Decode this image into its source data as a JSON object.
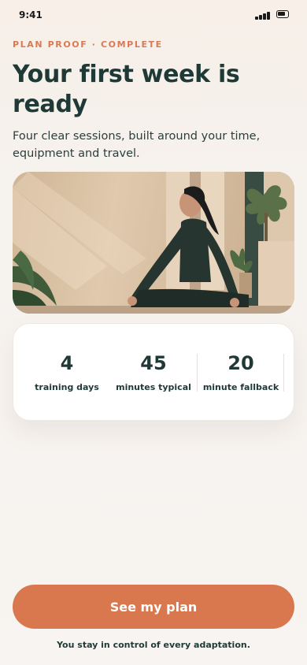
{
  "status": {
    "time": "9:41"
  },
  "header": {
    "eyebrow": "PLAN PROOF · COMPLETE",
    "title": "Your first week is ready",
    "subtitle": "Four clear sessions, built around your time, equipment and travel."
  },
  "stats": [
    {
      "value": "4",
      "label": "training days"
    },
    {
      "value": "45",
      "label": "minutes typical"
    },
    {
      "value": "20",
      "label": "minute fallback"
    }
  ],
  "cta": {
    "label": "See my plan"
  },
  "footnote": "You stay in control of every adaptation."
}
